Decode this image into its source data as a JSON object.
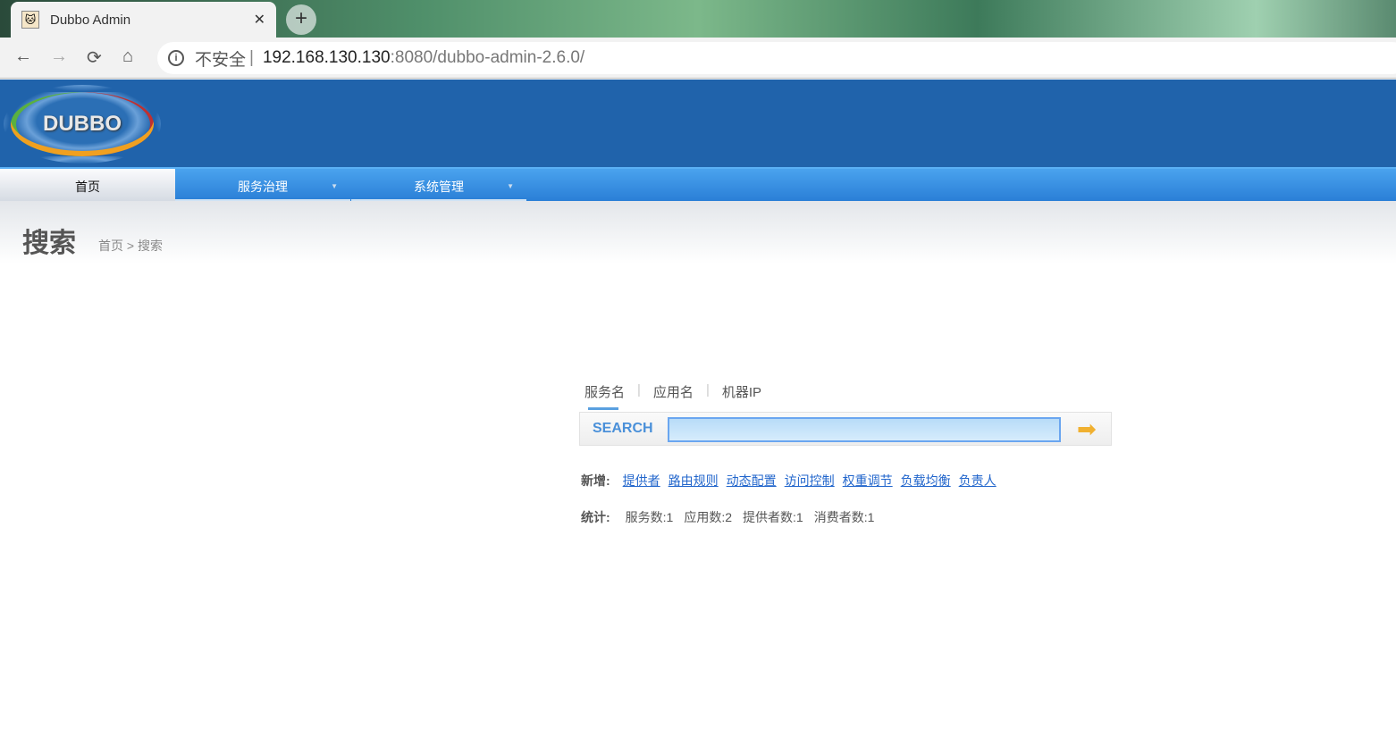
{
  "browser": {
    "tab_title": "Dubbo Admin",
    "close": "✕",
    "new_tab": "+",
    "back": "←",
    "forward": "→",
    "reload": "⟳",
    "home": "⌂",
    "info": "i",
    "insecure": "不安全",
    "separator": "|",
    "host": "192.168.130.130",
    "path": ":8080/dubbo-admin-2.6.0/"
  },
  "header": {
    "logo": "DUBBO"
  },
  "menu": [
    {
      "label": "首页"
    },
    {
      "label": "服务治理",
      "caret": "▼"
    },
    {
      "label": "系统管理",
      "caret": "▼"
    }
  ],
  "page": {
    "title": "搜索",
    "breadcrumb": "首页 > 搜索"
  },
  "search": {
    "tabs": [
      "服务名",
      "应用名",
      "机器IP"
    ],
    "label": "SEARCH",
    "value": "",
    "go": "➡"
  },
  "add": {
    "label": "新增:",
    "links": [
      "提供者",
      "路由规则",
      "动态配置",
      "访问控制",
      "权重调节",
      "负载均衡",
      "负责人"
    ]
  },
  "stats": {
    "label": "统计:",
    "items": [
      "服务数:1",
      "应用数:2",
      "提供者数:1",
      "消费者数:1"
    ]
  }
}
